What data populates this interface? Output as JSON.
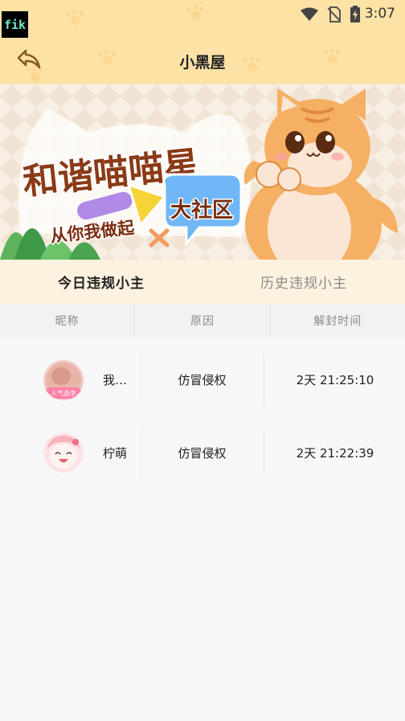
{
  "status_bar": {
    "app_badge": "fik",
    "time": "3:07",
    "icons": [
      "wifi-icon",
      "no-sim-icon",
      "battery-charging-icon"
    ]
  },
  "header": {
    "title": "小黑屋",
    "back_icon": "back-arrow-icon"
  },
  "banner": {
    "headline": "和谐喵喵星",
    "tagline": "大社区",
    "subline": "从你我做起"
  },
  "tabs": [
    {
      "label": "今日违规小主",
      "active": true
    },
    {
      "label": "历史违规小主",
      "active": false
    }
  ],
  "table": {
    "columns": [
      "昵称",
      "原因",
      "解封时间"
    ],
    "rows": [
      {
        "nickname": "我…",
        "avatar_badge": "人气选手",
        "reason": "仿冒侵权",
        "unban_time": "2天  21:25:10"
      },
      {
        "nickname": "柠萌",
        "avatar_badge": "",
        "reason": "仿冒侵权",
        "unban_time": "2天  21:22:39"
      }
    ]
  },
  "colors": {
    "header_bg": "#fde2a6",
    "tab_bar_bg": "#fdf2df",
    "page_bg": "#f7f7f7"
  }
}
